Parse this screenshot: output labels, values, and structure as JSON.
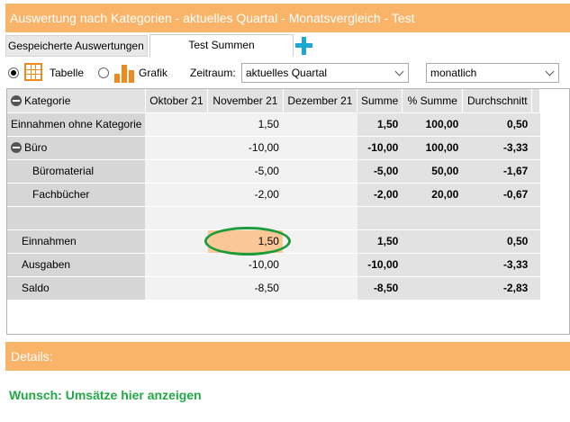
{
  "window": {
    "title": "Auswertung nach Kategorien - aktuelles Quartal - Monatsvergleich - Test"
  },
  "tabs": {
    "saved_label": "Gespeicherte Auswertungen",
    "active_label": "Test Summen"
  },
  "toolbar": {
    "view_table_label": "Tabelle",
    "view_chart_label": "Grafik",
    "selected_view": "Tabelle",
    "period_label": "Zeitraum:",
    "period_value": "aktuelles Quartal",
    "interval_value": "monatlich"
  },
  "table": {
    "headers": {
      "category": "Kategorie",
      "m1": "Oktober 21",
      "m2": "November 21",
      "m3": "Dezember 21",
      "sum": "Summe",
      "pct": "% Summe",
      "avg": "Durchschnitt"
    },
    "rows": [
      {
        "category": "Einnahmen ohne Kategorie",
        "m1": "",
        "m2": "1,50",
        "m3": "",
        "sum": "1,50",
        "pct": "100,00",
        "avg": "0,50"
      },
      {
        "category": "Büro",
        "m1": "",
        "m2": "-10,00",
        "m3": "",
        "sum": "-10,00",
        "pct": "100,00",
        "avg": "-3,33"
      },
      {
        "category": "Büromaterial",
        "m1": "",
        "m2": "-5,00",
        "m3": "",
        "sum": "-5,00",
        "pct": "50,00",
        "avg": "-1,67"
      },
      {
        "category": "Fachbücher",
        "m1": "",
        "m2": "-2,00",
        "m3": "",
        "sum": "-2,00",
        "pct": "20,00",
        "avg": "-0,67"
      },
      {
        "category": "",
        "m1": "",
        "m2": "",
        "m3": "",
        "sum": "",
        "pct": "",
        "avg": ""
      },
      {
        "category": "Einnahmen",
        "m1": "",
        "m2": "1,50",
        "m3": "",
        "sum": "1,50",
        "pct": "",
        "avg": "0,50"
      },
      {
        "category": "Ausgaben",
        "m1": "",
        "m2": "-10,00",
        "m3": "",
        "sum": "-10,00",
        "pct": "",
        "avg": "-3,33"
      },
      {
        "category": "Saldo",
        "m1": "",
        "m2": "-8,50",
        "m3": "",
        "sum": "-8,50",
        "pct": "",
        "avg": "-2,83"
      }
    ]
  },
  "details": {
    "label": "Details:"
  },
  "annotation": {
    "wish": "Wunsch: Umsätze hier anzeigen"
  },
  "colors": {
    "accent": "#f9b46a",
    "plus": "#1aa9d6",
    "highlight": "#fbc797",
    "annotation": "#1e9b3a"
  },
  "icons": {
    "add": "plus-icon",
    "table": "table-icon",
    "chart": "bar-chart-icon",
    "collapse": "minus-circle-icon",
    "dropdown": "chevron-down-icon"
  }
}
